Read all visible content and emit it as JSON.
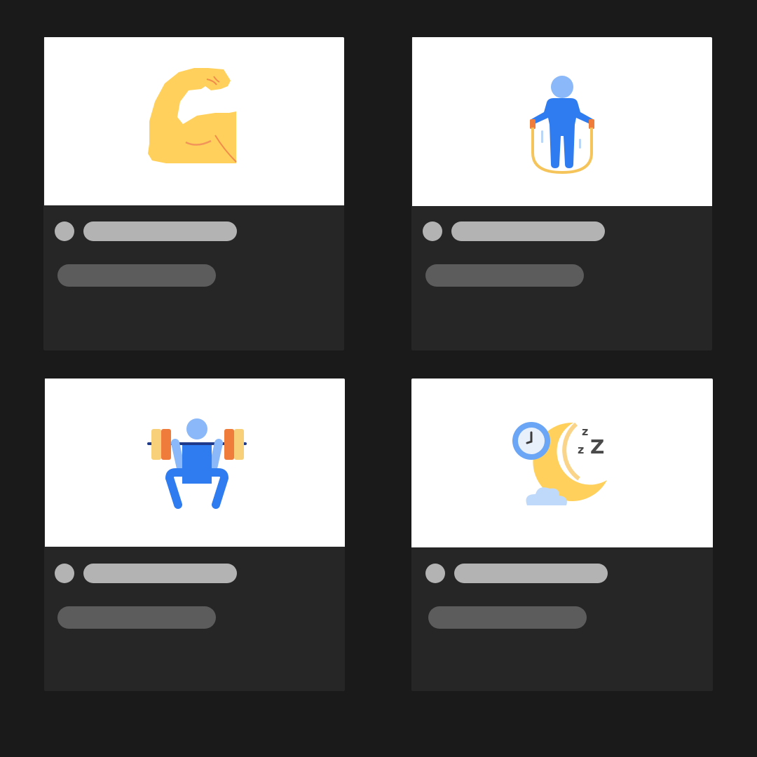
{
  "colors": {
    "background": "#1a1a1a",
    "card": "#262626",
    "thumbnail": "#ffffff",
    "title_placeholder": "#b3b3b3",
    "subtitle_placeholder": "#5c5c5c"
  },
  "cards": [
    {
      "icon": "flexed-biceps-icon",
      "state": "loading-placeholder"
    },
    {
      "icon": "jump-rope-icon",
      "state": "loading-placeholder"
    },
    {
      "icon": "weightlifting-squat-icon",
      "state": "loading-placeholder"
    },
    {
      "icon": "moon-sleep-clock-icon",
      "state": "loading-placeholder"
    }
  ]
}
